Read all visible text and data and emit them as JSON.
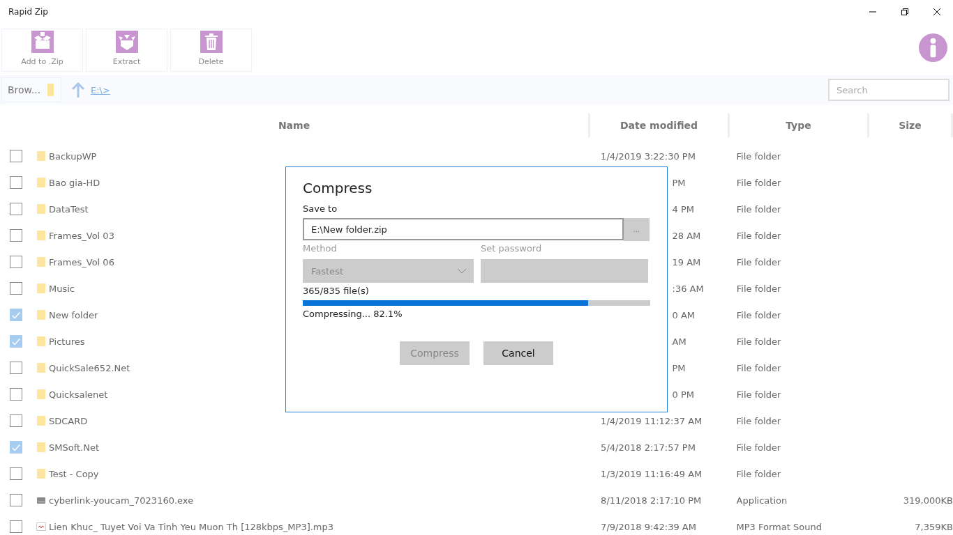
{
  "window": {
    "title": "Rapid Zip"
  },
  "toolbar": [
    {
      "label": "Add to .Zip",
      "kind": "add"
    },
    {
      "label": "Extract",
      "kind": "extract"
    },
    {
      "label": "Delete",
      "kind": "delete"
    }
  ],
  "path_bar": {
    "browse": "Brow...",
    "path": "E:\\>"
  },
  "search": {
    "placeholder": "Search"
  },
  "table": {
    "columns": [
      "Name",
      "Date modified",
      "Type",
      "Size"
    ],
    "rows": [
      {
        "name": "BackupWP",
        "date": "1/4/2019 3:22:30 PM",
        "type": "File folder",
        "kind": "folder",
        "checked": false
      },
      {
        "name": "Bao gia-HD",
        "date": "PM",
        "type": "File folder",
        "kind": "folder",
        "checked": false
      },
      {
        "name": "DataTest",
        "date": "4 PM",
        "type": "File folder",
        "kind": "folder",
        "checked": false
      },
      {
        "name": "Frames_Vol 03",
        "date": "28 AM",
        "type": "File folder",
        "kind": "folder",
        "checked": false
      },
      {
        "name": "Frames_Vol 06",
        "date": "19 AM",
        "type": "File folder",
        "kind": "folder",
        "checked": false
      },
      {
        "name": "Music",
        "date": ":36 AM",
        "type": "File folder",
        "kind": "folder",
        "checked": false
      },
      {
        "name": "New folder",
        "date": "0 AM",
        "type": "File folder",
        "kind": "folder",
        "checked": true
      },
      {
        "name": "Pictures",
        "date": "AM",
        "type": "File folder",
        "kind": "folder",
        "checked": true
      },
      {
        "name": "QuickSale652.Net",
        "date": "PM",
        "type": "File folder",
        "kind": "folder",
        "checked": false
      },
      {
        "name": "Quicksalenet",
        "date": "0 PM",
        "type": "File folder",
        "kind": "folder",
        "checked": false
      },
      {
        "name": "SDCARD",
        "date": "1/4/2019 11:12:37 AM",
        "type": "File folder",
        "kind": "folder",
        "checked": false
      },
      {
        "name": "SMSoft.Net",
        "date": "5/4/2018 2:17:57 PM",
        "type": "File folder",
        "kind": "folder",
        "checked": true
      },
      {
        "name": "Test - Copy",
        "date": "1/3/2019 11:16:49 AM",
        "type": "File folder",
        "kind": "folder",
        "checked": false
      },
      {
        "name": "cyberlink-youcam_7023160.exe",
        "date": "8/11/2018 2:17:10 PM",
        "type": "Application",
        "size": "319,000KB",
        "kind": "application",
        "checked": false
      },
      {
        "name": "Lien Khuc_ Tuyet Voi Va Tinh Yeu Muon Th [128kbps_MP3].mp3",
        "date": "7/9/2018 9:42:39 AM",
        "type": "MP3 Format Sound",
        "size": "7,359KB",
        "kind": "audio",
        "checked": false
      }
    ]
  },
  "dialog": {
    "title": "Compress",
    "save_to_label": "Save to",
    "save_to_value": "E:\\New folder.zip",
    "browse_button": "...",
    "method_label": "Method",
    "method_value": "Fastest",
    "password_label": "Set password",
    "file_count": "365/835 file(s)",
    "level": 0.821,
    "status": "Compressing... 82.1%",
    "buttons": [
      {
        "label": "Compress",
        "disabled": true
      },
      {
        "label": "Cancel",
        "disabled": false
      }
    ]
  }
}
